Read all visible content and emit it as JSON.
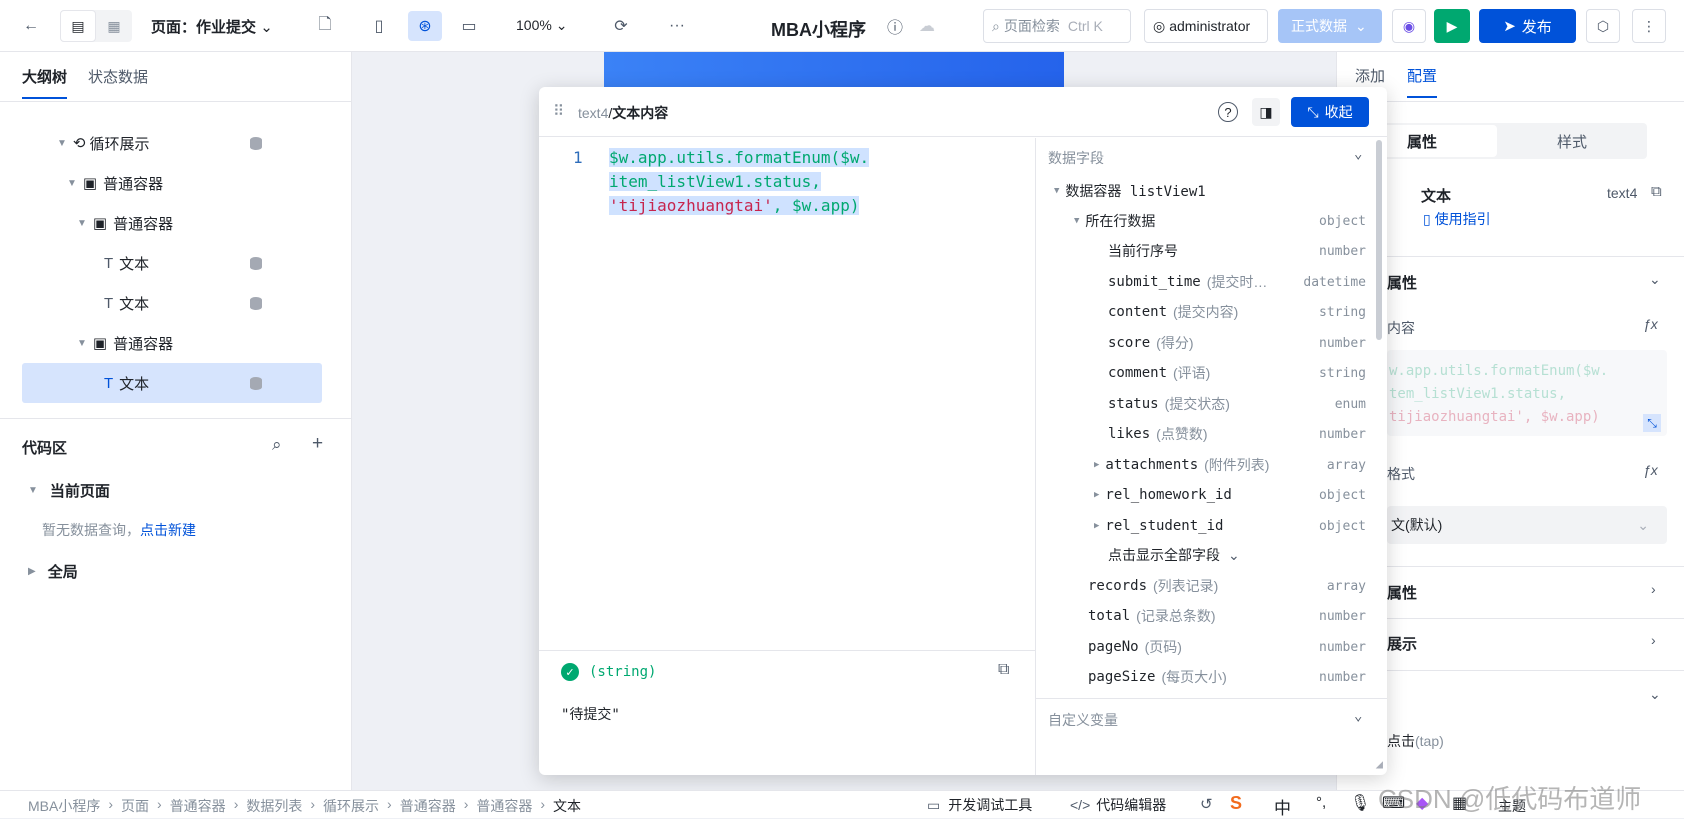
{
  "topbar": {
    "page_label": "页面：作业提交",
    "zoom": "100%",
    "more": "···",
    "app_title": "MBA小程序",
    "search_placeholder": "页面检索",
    "search_shortcut": "Ctrl K",
    "user": "administrator",
    "env": "正式数据",
    "publish": "发布"
  },
  "left": {
    "tabs": [
      "大纲树",
      "状态数据"
    ],
    "tree": [
      {
        "label": "循环展示",
        "icon": "loop-icon"
      },
      {
        "label": "普通容器",
        "icon": "container-icon"
      },
      {
        "label": "普通容器",
        "icon": "container-icon"
      },
      {
        "label": "文本",
        "icon": "text-icon"
      },
      {
        "label": "文本",
        "icon": "text-icon"
      },
      {
        "label": "普通容器",
        "icon": "container-icon"
      },
      {
        "label": "文本",
        "icon": "text-icon"
      }
    ],
    "code_title": "代码区",
    "current_page": "当前页面",
    "empty_text": "暂无数据查询，",
    "create_link": "点击新建",
    "global": "全局"
  },
  "popup": {
    "crumb_component": "text4",
    "crumb_sep": "/",
    "crumb_field": "文本内容",
    "collapse": "收起",
    "line_no": "1",
    "code_line1": "$w.app.utils.formatEnum($w.",
    "code_line2": "item_listView1.status, ",
    "code_line3a": "'tijiaozhuangtai'",
    "code_line3b": ", $w.app)",
    "result_type": "(string)",
    "result_value": "\"待提交\"",
    "fields_title": "数据字段",
    "container": "数据容器 listView1",
    "row_data": "所在行数据",
    "row_data_type": "object",
    "fields": [
      {
        "name": "当前行序号",
        "cn": "",
        "type": "number"
      },
      {
        "name": "submit_time",
        "cn": "(提交时…",
        "type": "datetime"
      },
      {
        "name": "content",
        "cn": "(提交内容)",
        "type": "string"
      },
      {
        "name": "score",
        "cn": "(得分)",
        "type": "number"
      },
      {
        "name": "comment",
        "cn": "(评语)",
        "type": "string"
      },
      {
        "name": "status",
        "cn": "(提交状态)",
        "type": "enum"
      },
      {
        "name": "likes",
        "cn": "(点赞数)",
        "type": "number"
      },
      {
        "name": "attachments",
        "cn": "(附件列表)",
        "type": "array"
      },
      {
        "name": "rel_homework_id",
        "cn": "",
        "type": "object"
      },
      {
        "name": "rel_student_id",
        "cn": "",
        "type": "object"
      }
    ],
    "show_all": "点击显示全部字段",
    "list_fields": [
      {
        "name": "records",
        "cn": "(列表记录)",
        "type": "array"
      },
      {
        "name": "total",
        "cn": "(记录总条数)",
        "type": "number"
      },
      {
        "name": "pageNo",
        "cn": "(页码)",
        "type": "number"
      },
      {
        "name": "pageSize",
        "cn": "(每页大小)",
        "type": "number"
      }
    ],
    "custom_vars": "自定义变量"
  },
  "right": {
    "tabs": [
      "添加",
      "配置"
    ],
    "subtabs": [
      "属性",
      "样式"
    ],
    "comp_name": "文本",
    "comp_id": "text4",
    "guide": "使用指引",
    "section_props": "属性",
    "content_label": "内容",
    "content_code1": "w.app.utils.formatEnum($w.",
    "content_code2": "tem_listView1.status,",
    "content_code3": "tijiaozhuangtai', $w.app)",
    "format_label": "格式",
    "format_value": "文(默认)",
    "more_props": "属性",
    "display": "展示",
    "event": "点击",
    "event_tap": "(tap)"
  },
  "bottom": {
    "crumbs": [
      "MBA小程序",
      "页面",
      "普通容器",
      "数据列表",
      "循环展示",
      "普通容器",
      "普通容器",
      "文本"
    ],
    "devtools": "开发调试工具",
    "code_editor": "代码编辑器",
    "ime": "中",
    "theme": "主题",
    "watermark": "CSDN @低代码布道师"
  },
  "colors": {
    "primary": "#0052d9",
    "accent_green": "#00a870",
    "code_green": "#00a870",
    "code_red": "#c7254e",
    "selection": "#cfe2ff"
  }
}
